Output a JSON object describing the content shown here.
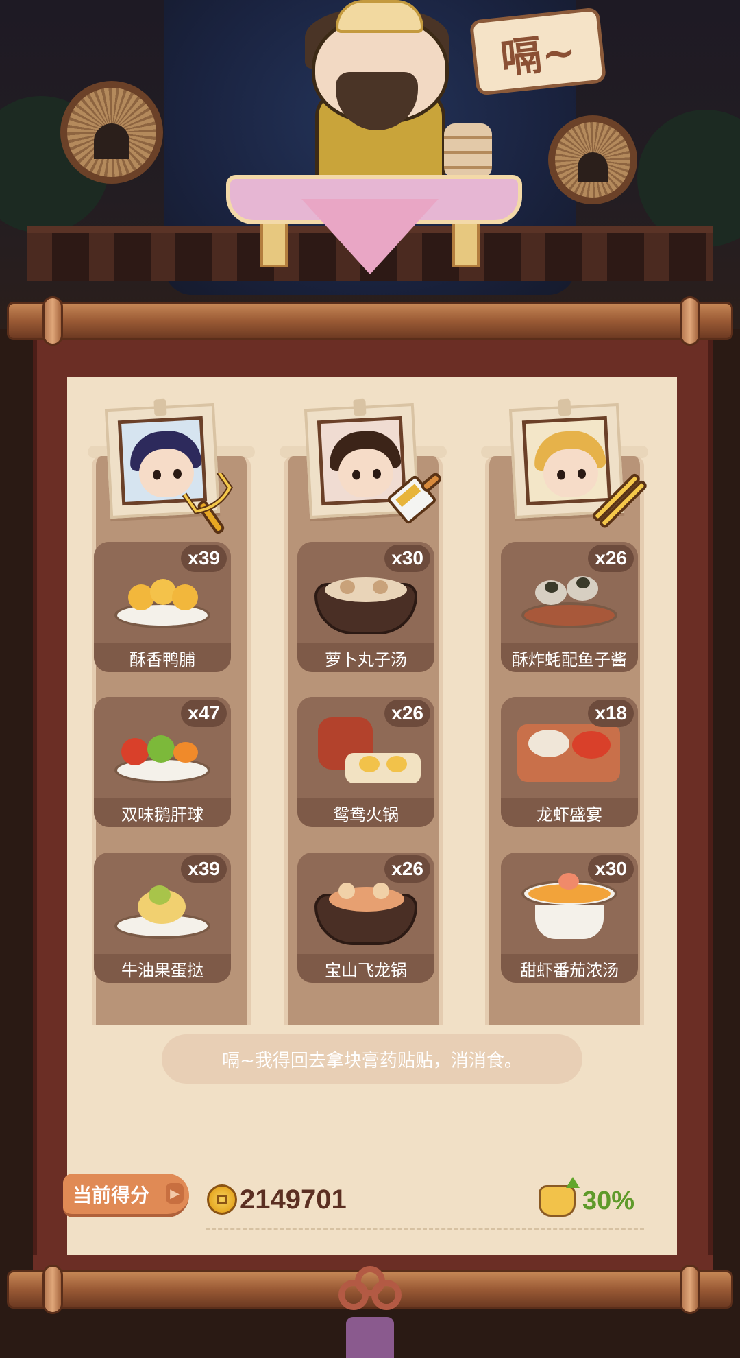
{
  "header": {
    "speech_sign": "嗝~"
  },
  "chefs": [
    {
      "name": "chef-1",
      "tool": "fork"
    },
    {
      "name": "chef-2",
      "tool": "cleaver"
    },
    {
      "name": "chef-3",
      "tool": "chopsticks"
    }
  ],
  "dishes": [
    [
      {
        "name": "酥香鸭脯",
        "count": "x39"
      },
      {
        "name": "双味鹅肝球",
        "count": "x47"
      },
      {
        "name": "牛油果蛋挞",
        "count": "x39"
      }
    ],
    [
      {
        "name": "萝卜丸子汤",
        "count": "x30"
      },
      {
        "name": "鸳鸯火锅",
        "count": "x26"
      },
      {
        "name": "宝山飞龙锅",
        "count": "x26"
      }
    ],
    [
      {
        "name": "酥炸蚝配鱼子酱",
        "count": "x26"
      },
      {
        "name": "龙虾盛宴",
        "count": "x18"
      },
      {
        "name": "甜虾番茄浓汤",
        "count": "x30"
      }
    ]
  ],
  "comment": "嗝~我得回去拿块膏药贴贴，消消食。",
  "score": {
    "label": "当前得分",
    "value": "2149701",
    "bonus": "30%"
  },
  "colors": {
    "scroll_frame": "#6b2e25",
    "paper": "#f1e0c6",
    "column": "#b89478",
    "card": "#8a6552",
    "score_tag": "#e08a55",
    "score_text": "#5b2f22",
    "bonus_text": "#5f9a2a"
  },
  "icons": [
    "coin-icon",
    "bonus-pot-icon",
    "fork-icon",
    "cleaver-icon",
    "chopsticks-icon"
  ]
}
